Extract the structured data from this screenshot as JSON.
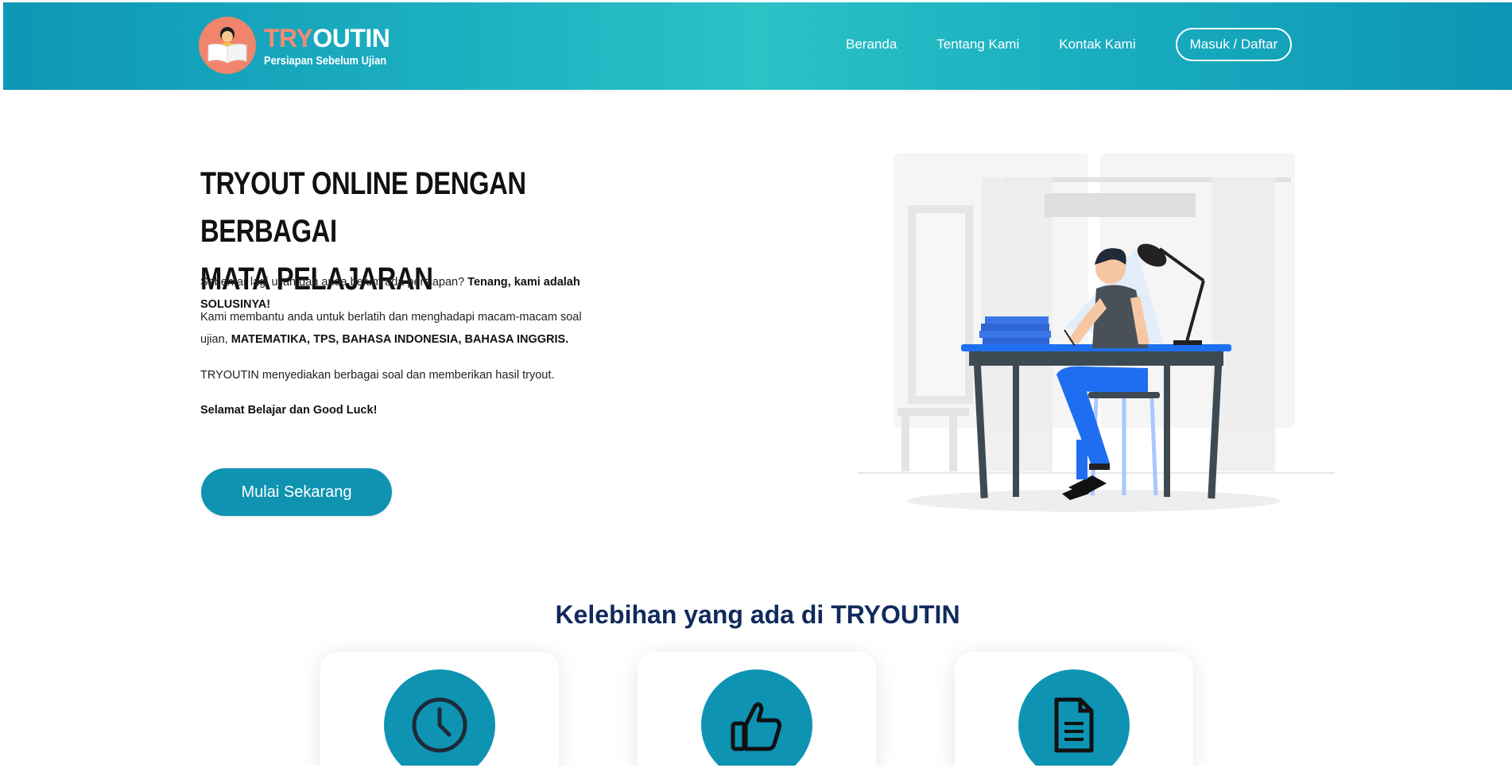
{
  "brand": {
    "name_part1": "TRY",
    "name_part2": "OUTIN",
    "tagline": "Persiapan Sebelum Ujian",
    "logo_icon": "reading-person-icon"
  },
  "nav": {
    "items": [
      "Beranda",
      "Tentang Kami",
      "Kontak Kami"
    ],
    "login_label": "Masuk / Daftar"
  },
  "hero": {
    "title_line1": "TRYOUT ONLINE DENGAN BERBAGAI",
    "title_line2": "MATA PELAJARAN",
    "p1_text": "Sebentar lagi ujian dan anda belum ada persiapan? ",
    "p1_bold": "Tenang, kami adalah SOLUSINYA!",
    "p2_text_a": "Kami membantu anda untuk berlatih dan menghadapi macam-macam soal",
    "p2_text_b": "ujian, ",
    "p2_bold": "MATEMATIKA, TPS, BAHASA INDONESIA, BAHASA INGGRIS.",
    "p3_text": "TRYOUTIN menyediakan berbagai soal dan memberikan hasil tryout.",
    "p4_bold": "Selamat Belajar dan Good Luck!",
    "cta_label": "Mulai Sekarang"
  },
  "features": {
    "title": "Kelebihan yang ada di TRYOUTIN",
    "cards": [
      {
        "icon": "clock-icon"
      },
      {
        "icon": "thumbs-up-icon"
      },
      {
        "icon": "document-icon"
      }
    ]
  },
  "colors": {
    "primary": "#0f93b1",
    "accent": "#f58b72",
    "heading": "#102a5c"
  }
}
